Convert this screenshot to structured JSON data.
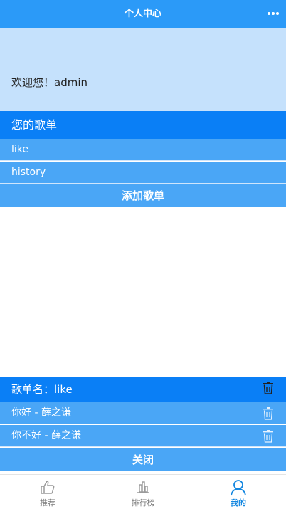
{
  "header": {
    "title": "个人中心",
    "more_icon": "more-icon"
  },
  "welcome": {
    "text": "欢迎您！admin"
  },
  "playlists": {
    "heading": "您的歌单",
    "items": [
      {
        "label": "like"
      },
      {
        "label": "history"
      }
    ],
    "add_label": "添加歌单"
  },
  "panel": {
    "title": "歌单名：like",
    "songs": [
      {
        "label": "你好 - 薛之谦"
      },
      {
        "label": "你不好 - 薛之谦"
      }
    ],
    "close_label": "关闭"
  },
  "tabbar": {
    "items": [
      {
        "label": "推荐",
        "icon": "thumbs-up-icon",
        "active": false
      },
      {
        "label": "排行榜",
        "icon": "bar-chart-icon",
        "active": false
      },
      {
        "label": "我的",
        "icon": "user-icon",
        "active": true
      }
    ]
  },
  "colors": {
    "primary": "#0a7ff6",
    "row": "#4aa6f6",
    "header": "#2b9af8",
    "welcome_bg": "#c5e1fc",
    "active_tab": "#1487e0"
  }
}
